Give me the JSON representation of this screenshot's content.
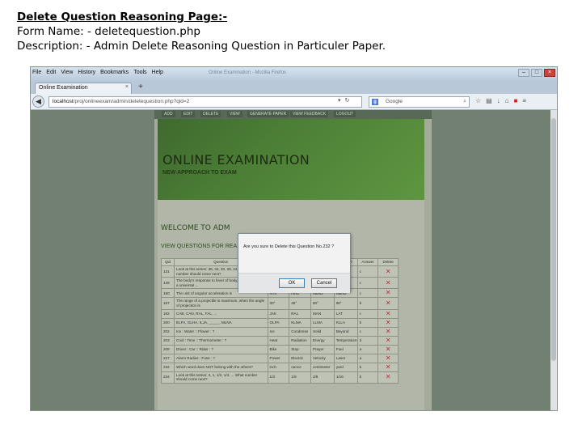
{
  "caption": {
    "heading": "Delete Question Reasoning Page:-",
    "form_name": "Form Name: - deletequestion.php",
    "description": "Description: - Admin Delete Reasoning Question in Particuler Paper."
  },
  "browser": {
    "menu": [
      "File",
      "Edit",
      "View",
      "History",
      "Bookmarks",
      "Tools",
      "Help"
    ],
    "window_title": "Online Examination - Mozilla Firefox",
    "tab_title": "Online Examination",
    "tab_close": "×",
    "new_tab": "+",
    "back": "◀",
    "url_host": "localhost",
    "url_path": "/proj/onlineexam/admin/deletequestion.php?qid=2",
    "search_engine": "g",
    "search_placeholder": "Google",
    "win_minimize": "–",
    "win_maximize": "□",
    "win_close": "×"
  },
  "site": {
    "nav": [
      "ADD",
      "EDIT",
      "DELETE",
      "VIEW",
      "GENERATE PAPER",
      "VIEW FEEDBACK",
      "LOGOUT"
    ],
    "title": "ONLINE EXAMINATION",
    "subtitle": "NEW APPROACH TO EXAM",
    "welcome": "WELCOME TO ADM",
    "view_heading": "VIEW QUESTIONS FOR REA"
  },
  "table": {
    "headers": [
      "Qid",
      "Question",
      "optionA",
      "optionB",
      "optionC",
      "optionD",
      "Answer",
      "Delete"
    ],
    "delete_icon": "✕",
    "rows": [
      [
        "131",
        "Look at this series: 36, 34, 30, 28, 24, 22, ... What number should come next?",
        "20",
        "22",
        "23",
        "26",
        "c"
      ],
      [
        "149",
        "The body's response to fever of body, when in nature a universal ...",
        "Isaac Newton",
        "Isabel Newton",
        "Eyerine Newton",
        "Isaac Newton",
        "c"
      ],
      [
        "160",
        "The unit of angular acceleration is",
        "N·m",
        "m/s2",
        "rad/s2",
        "rad/s2",
        "c"
      ],
      [
        "167",
        "The range of a projectile is maximum, when the angle of projection is",
        "30°",
        "45°",
        "60°",
        "90°",
        "b"
      ],
      [
        "182",
        "CAB, CAN, RAL, FAL, ...",
        "JAK",
        "RAL",
        "MAN",
        "LAT",
        "c"
      ],
      [
        "200",
        "ELFA, GLHA, ILJA, _____, MLNA",
        "OLPA",
        "KLMA",
        "LLMA",
        "KLLA",
        "b"
      ],
      [
        "202",
        "Ice : Water :: Flower : ?",
        "Ice",
        "Condense",
        "Solid",
        "Beyond",
        "c"
      ],
      [
        "203",
        "Cool : Time :: Thermometer : ?",
        "Heat",
        "Radiation",
        "Energy",
        "Temperature",
        "d"
      ],
      [
        "208",
        "Driver : Car :: Rider : ?",
        "Bike",
        "Stop",
        "Prayer",
        "Fuel",
        "a"
      ],
      [
        "227",
        "Alarm Radius : Fuse : ?",
        "Power",
        "Electric",
        "Velocity",
        "Laser",
        "a"
      ],
      [
        "232",
        "Which word does NOT belong with the others?",
        "inch",
        "ounce",
        "centimeter",
        "yard",
        "b"
      ],
      [
        "234",
        "Look at this series: 2, 1, 1/2, 1/4, ... What number should come next?",
        "1/3",
        "1/8",
        "2/8",
        "1/16",
        "b"
      ]
    ]
  },
  "dialog": {
    "message": "Are you sure to Delete this Question No.232 ?",
    "ok_label": "OK",
    "cancel_label": "Cancel"
  }
}
